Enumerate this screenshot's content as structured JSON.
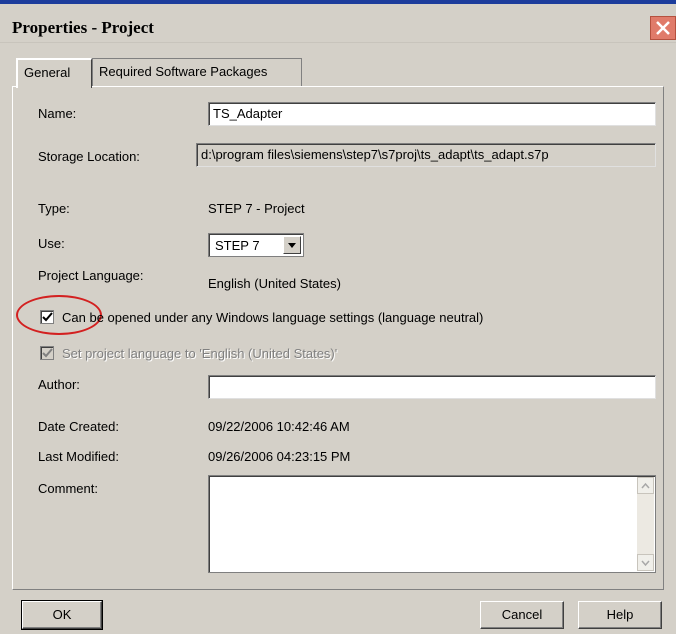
{
  "window": {
    "title": "Properties - Project"
  },
  "tabs": [
    {
      "label": "General"
    },
    {
      "label": "Required Software Packages"
    }
  ],
  "form": {
    "name_label": "Name:",
    "name_value": "TS_Adapter",
    "storage_label": "Storage Location:",
    "storage_value": "d:\\program files\\siemens\\step7\\s7proj\\ts_adapt\\ts_adapt.s7p",
    "type_label": "Type:",
    "type_value": "STEP 7 - Project",
    "use_label": "Use:",
    "use_value": "STEP 7",
    "language_label": "Project Language:",
    "language_value": "English (United States)",
    "neutral_checkbox_label": "Can be opened under any Windows language settings (language neutral)",
    "neutral_checked": true,
    "set_language_label": "Set project language to 'English (United States)'",
    "set_language_checked": true,
    "author_label": "Author:",
    "author_value": "",
    "created_label": "Date Created:",
    "created_value": "09/22/2006 10:42:46 AM",
    "modified_label": "Last Modified:",
    "modified_value": "09/26/2006 04:23:15 PM",
    "comment_label": "Comment:",
    "comment_value": ""
  },
  "buttons": {
    "ok": "OK",
    "cancel": "Cancel",
    "help": "Help"
  },
  "colors": {
    "dialog_bg": "#d4d0c8",
    "title_line": "#1c3c9c",
    "close_bg": "#e07b6a",
    "annotation_circle": "#d32020"
  },
  "icons": {
    "close": "close-icon",
    "dropdown": "chevron-down-icon",
    "check": "checkmark-icon"
  }
}
